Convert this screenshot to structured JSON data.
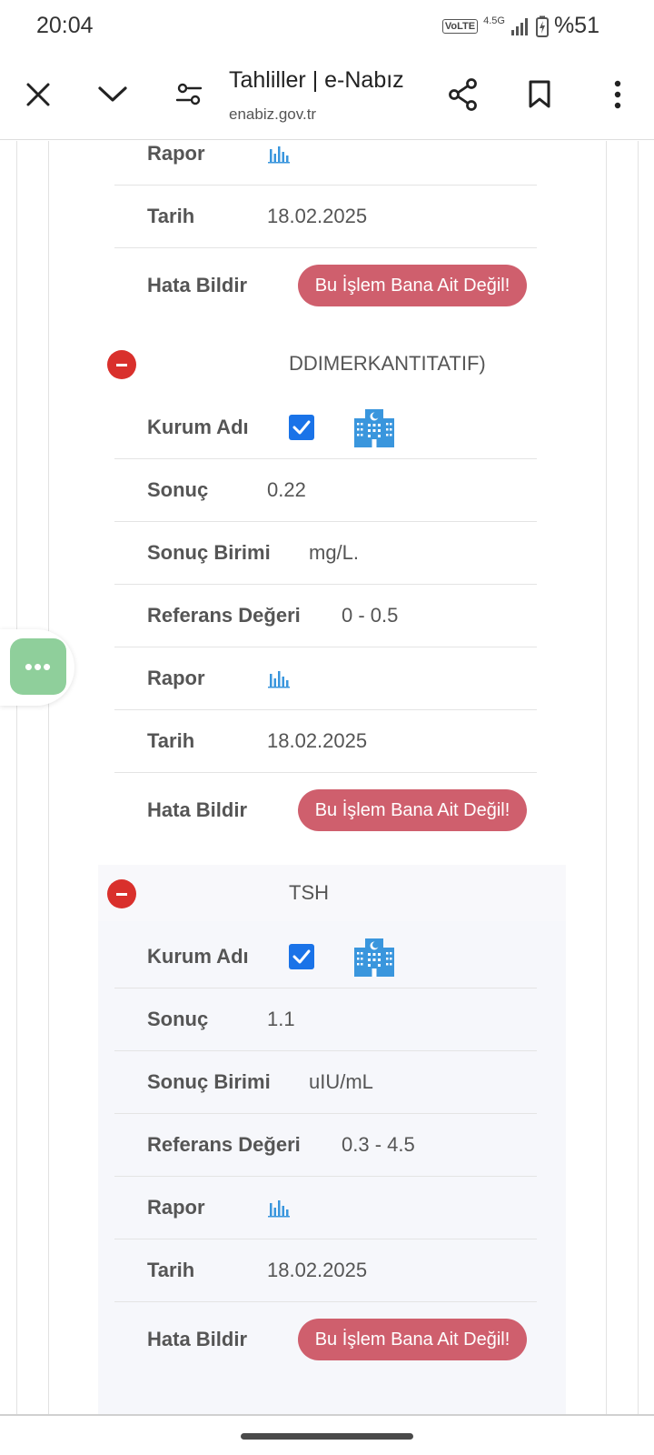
{
  "status_bar": {
    "time": "20:04",
    "volte": "VoLTE",
    "network": "4.5G",
    "battery": "%51"
  },
  "browser": {
    "title": "Tahliller | e-Nabız",
    "url": "enabiz.gov.tr"
  },
  "labels": {
    "kurum_adi": "Kurum Adı",
    "sonuc": "Sonuç",
    "sonuc_birimi": "Sonuç Birimi",
    "referans": "Referans Değeri",
    "rapor": "Rapor",
    "tarih": "Tarih",
    "hata_bildir": "Hata Bildir",
    "hata_button": "Bu İşlem Bana Ait Değil!"
  },
  "partial_section": {
    "tarih": "18.02.2025"
  },
  "ddimer": {
    "title": "DDIMERKANTITATIF)",
    "sonuc": "0.22",
    "birim": "mg/L.",
    "referans": "0 - 0.5",
    "tarih": "18.02.2025"
  },
  "tsh": {
    "title": "TSH",
    "sonuc": "1.1",
    "birim": "uIU/mL",
    "referans": "0.3 - 4.5",
    "tarih": "18.02.2025"
  },
  "fab": {
    "label": "•••"
  },
  "colors": {
    "error_button": "#cf5f6d",
    "collapse_icon": "#d9302c",
    "checkbox": "#1a73e8",
    "hospital_icon": "#3a96dd",
    "fab": "#8fcf9b"
  }
}
